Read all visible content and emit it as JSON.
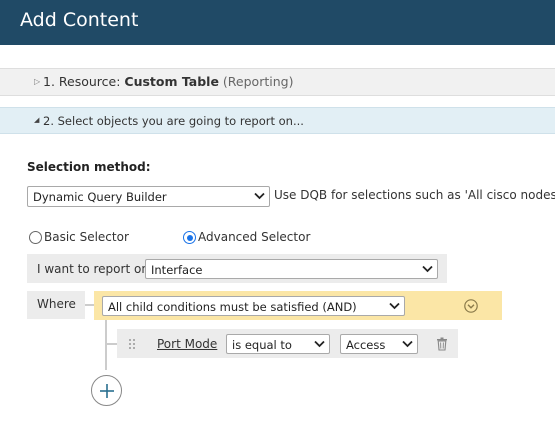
{
  "header": {
    "title": "Add Content"
  },
  "section1": {
    "arrow": "▷",
    "prefix": "1. Resource: ",
    "resource": "Custom Table",
    "suffix": "(Reporting)"
  },
  "section2": {
    "arrow": "◢",
    "label": "2. Select objects you are going to report on..."
  },
  "selection": {
    "label": "Selection method:",
    "value": "Dynamic Query Builder",
    "hint": "Use DQB for selections such as 'All cisco nodes"
  },
  "selector": {
    "basic": "Basic Selector",
    "advanced": "Advanced Selector",
    "selected": "advanced"
  },
  "report": {
    "label": "I want to report on",
    "value": "Interface"
  },
  "where": {
    "label": "Where",
    "condition": "All child conditions must be satisfied (AND)"
  },
  "rule": {
    "field": "Port Mode",
    "operator": "is equal to",
    "value": "Access"
  },
  "icons": {
    "collapse": "chevron-circle-down-icon",
    "drag": "drag-handle-icon",
    "delete": "trash-icon",
    "add": "plus-circle-icon"
  },
  "colors": {
    "header_bg": "#204a66",
    "section2_bg": "#e2eff5",
    "and_bar_bg": "#fbe6a6",
    "radio_accent": "#1a73e8"
  }
}
